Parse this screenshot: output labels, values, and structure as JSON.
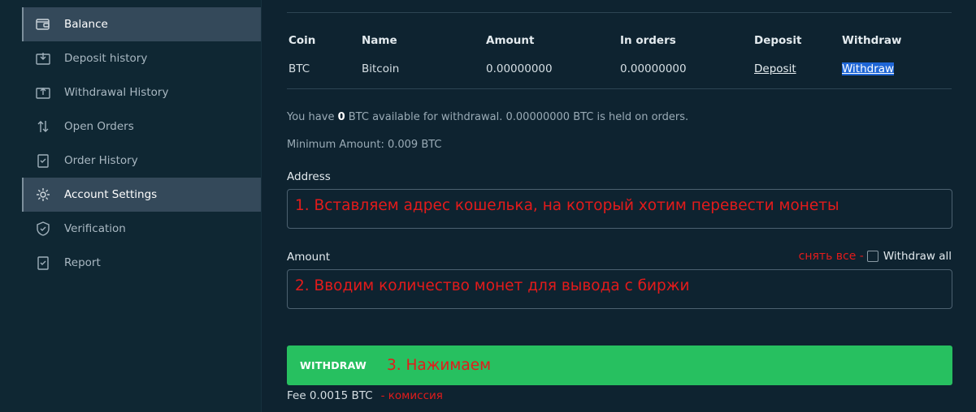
{
  "sidebar": {
    "items": [
      {
        "label": "Balance",
        "icon": "wallet-icon",
        "active": true
      },
      {
        "label": "Deposit history",
        "icon": "deposit-tray-icon",
        "active": false
      },
      {
        "label": "Withdrawal History",
        "icon": "withdraw-tray-icon",
        "active": false
      },
      {
        "label": "Open Orders",
        "icon": "swap-arrows-icon",
        "active": false
      },
      {
        "label": "Order History",
        "icon": "clipboard-check-icon",
        "active": false
      },
      {
        "label": "Account Settings",
        "icon": "gear-icon",
        "active": true
      },
      {
        "label": "Verification",
        "icon": "shield-check-icon",
        "active": false
      },
      {
        "label": "Report",
        "icon": "clipboard-report-icon",
        "active": false
      }
    ]
  },
  "table": {
    "headers": {
      "coin": "Coin",
      "name": "Name",
      "amount": "Amount",
      "in_orders": "In orders",
      "deposit": "Deposit",
      "withdraw": "Withdraw"
    },
    "row": {
      "coin": "BTC",
      "name": "Bitcoin",
      "amount": "0.00000000",
      "in_orders": "0.00000000",
      "deposit": "Deposit",
      "withdraw": "Withdraw"
    }
  },
  "info": {
    "available_prefix": "You have ",
    "available_amount": "0",
    "available_suffix": " BTC available for withdrawal. 0.00000000 BTC is held on orders.",
    "minimum": "Minimum Amount: 0.009 BTC"
  },
  "form": {
    "address_label": "Address",
    "address_annotation": "1. Вставляем адрес кошелька, на который хотим перевести монеты",
    "amount_label": "Amount",
    "amount_annotation": "2. Вводим количество монет для вывода с биржи",
    "withdraw_all_annotation": "снять все -",
    "withdraw_all_label": "Withdraw all"
  },
  "button": {
    "label": "WITHDRAW",
    "annotation": "3. Нажимаем"
  },
  "fee": {
    "text": "Fee 0.0015 BTC",
    "annotation": "- комиссия"
  },
  "colors": {
    "background": "#0e2330",
    "accent_green": "#27c060",
    "annotation_red": "#e31b1b",
    "active_item": "#34495a"
  }
}
